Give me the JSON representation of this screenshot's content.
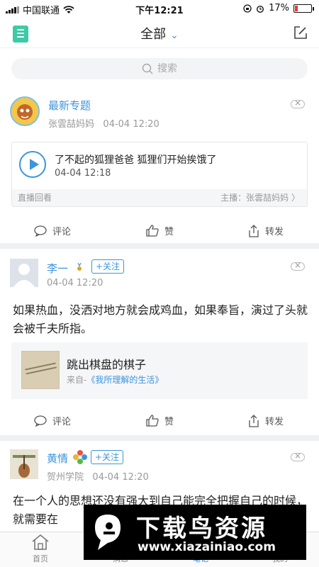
{
  "status_bar": {
    "carrier": "中国联通",
    "time": "下午12:21",
    "battery": "17%",
    "battery_level": 0.17
  },
  "nav": {
    "title": "全部"
  },
  "search": {
    "placeholder": "搜索"
  },
  "posts": [
    {
      "name": "最新专题",
      "author": "张雲喆妈妈",
      "time": "04-04 12:20",
      "live": {
        "title": "了不起的狐狸爸爸 狐狸们开始挨饿了",
        "time": "04-04 12:18",
        "footer_left": "直播回看",
        "footer_right": "主播：张雲喆妈妈 〉"
      },
      "actions": {
        "comment": "评论",
        "like": "赞",
        "share": "转发"
      }
    },
    {
      "name": "李一",
      "follow": "+关注",
      "time": "04-04 12:20",
      "text": "如果热血，没洒对地方就会成鸡血，如果奉旨，演过了头就会被千夫所指。",
      "share": {
        "title": "跳出棋盘的棋子",
        "source_prefix": "来自-",
        "source_link": "《我所理解的生活》"
      },
      "actions": {
        "comment": "评论",
        "like": "赞",
        "share": "转发"
      }
    },
    {
      "name": "黄情",
      "follow": "+关注",
      "school": "贺州学院",
      "time": "04-04 12:20",
      "text": "在一个人的思想还没有强大到自己能完全把握自己的时候，就需要在"
    }
  ],
  "tabs": [
    {
      "label": "首页"
    },
    {
      "label": "消息"
    },
    {
      "label": "笔记"
    },
    {
      "label": "我的"
    }
  ],
  "watermark": {
    "title": "下载鸟资源",
    "url": "www.xiazainiao.com"
  }
}
